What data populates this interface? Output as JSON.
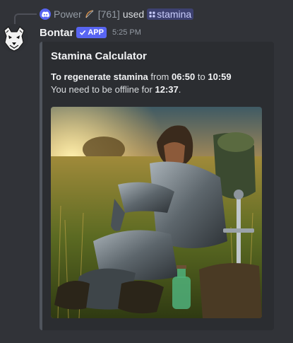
{
  "reply": {
    "user": "Power",
    "emoji_icon": "hunting-bow-icon",
    "tag": "[761]",
    "used_text": "used",
    "command": "stamina"
  },
  "message": {
    "author": "Bontar",
    "badge": "APP",
    "time": "5:25 PM"
  },
  "embed": {
    "title": "Stamina Calculator",
    "line1_bold": "To regenerate stamina",
    "line1_from": "from",
    "from_time": "06:50",
    "line1_to": "to",
    "to_time": "10:59",
    "line2_prefix": "You need to be offline for",
    "duration": "12:37",
    "line2_suffix": "."
  },
  "colors": {
    "background": "#313338",
    "embed_bg": "#2b2d31",
    "blurple": "#5865f2"
  }
}
